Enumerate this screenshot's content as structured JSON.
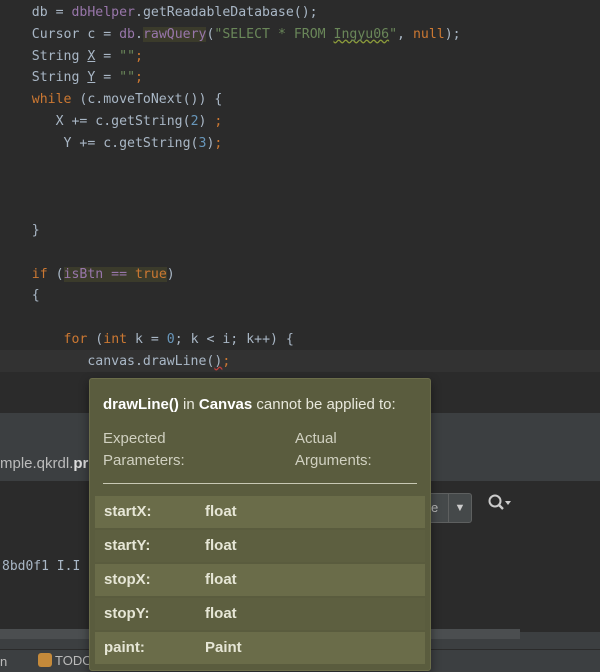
{
  "editor": {
    "lines": [
      {
        "segments": [
          {
            "t": "    db = ",
            "c": ""
          },
          {
            "t": "dbHelper",
            "c": "fld"
          },
          {
            "t": ".getReadableDatabase();",
            "c": ""
          }
        ]
      },
      {
        "segments": [
          {
            "t": "    Cursor c = ",
            "c": ""
          },
          {
            "t": "db",
            "c": "fld"
          },
          {
            "t": ".",
            "c": ""
          },
          {
            "t": "rawQuery",
            "c": "hlbox"
          },
          {
            "t": "(",
            "c": ""
          },
          {
            "t": "\"SELECT * FROM ",
            "c": "str"
          },
          {
            "t": "Ingyu06",
            "c": "strsq"
          },
          {
            "t": "\"",
            "c": "str"
          },
          {
            "t": ", ",
            "c": ""
          },
          {
            "t": "null",
            "c": "kw"
          },
          {
            "t": ");",
            "c": ""
          }
        ]
      },
      {
        "segments": [
          {
            "t": "    String ",
            "c": ""
          },
          {
            "t": "X",
            "c": "ul"
          },
          {
            "t": " = ",
            "c": ""
          },
          {
            "t": "\"\"",
            "c": "str"
          },
          {
            "t": ";",
            "c": "kw"
          }
        ]
      },
      {
        "segments": [
          {
            "t": "    String ",
            "c": ""
          },
          {
            "t": "Y",
            "c": "ul"
          },
          {
            "t": " = ",
            "c": ""
          },
          {
            "t": "\"\"",
            "c": "str"
          },
          {
            "t": ";",
            "c": "kw"
          }
        ]
      },
      {
        "segments": [
          {
            "t": "    ",
            "c": ""
          },
          {
            "t": "while",
            "c": "kw"
          },
          {
            "t": " (c.moveToNext()) {",
            "c": ""
          }
        ]
      },
      {
        "segments": [
          {
            "t": "       X += c.getString(",
            "c": ""
          },
          {
            "t": "2",
            "c": "num"
          },
          {
            "t": ") ",
            "c": ""
          },
          {
            "t": ";",
            "c": "kw"
          }
        ]
      },
      {
        "segments": [
          {
            "t": "        Y += c.getString(",
            "c": ""
          },
          {
            "t": "3",
            "c": "num"
          },
          {
            "t": ")",
            "c": ""
          },
          {
            "t": ";",
            "c": "kw"
          }
        ]
      },
      {
        "segments": []
      },
      {
        "segments": []
      },
      {
        "segments": []
      },
      {
        "segments": [
          {
            "t": "    }",
            "c": ""
          }
        ]
      },
      {
        "segments": []
      },
      {
        "segments": [
          {
            "t": "    ",
            "c": ""
          },
          {
            "t": "if",
            "c": "kw"
          },
          {
            "t": " (",
            "c": ""
          },
          {
            "t": "isBtn == ",
            "c": "hlfld"
          },
          {
            "t": "true",
            "c": "hlkw"
          },
          {
            "t": ")",
            "c": ""
          }
        ]
      },
      {
        "segments": [
          {
            "t": "    {",
            "c": ""
          }
        ]
      },
      {
        "segments": []
      },
      {
        "segments": [
          {
            "t": "        ",
            "c": ""
          },
          {
            "t": "for",
            "c": "kw"
          },
          {
            "t": " (",
            "c": ""
          },
          {
            "t": "int",
            "c": "kw"
          },
          {
            "t": " k = ",
            "c": ""
          },
          {
            "t": "0",
            "c": "num"
          },
          {
            "t": "; k < i; k++) {",
            "c": ""
          }
        ]
      },
      {
        "segments": [
          {
            "t": "           canvas.drawLine(",
            "c": ""
          },
          {
            "t": ")",
            "c": "err"
          },
          {
            "t": ";",
            "c": "kw"
          }
        ]
      }
    ]
  },
  "panel": {
    "tab_prefix": "mple.qkrdl.",
    "tab_bold": "pr",
    "log_line": "8bd0f1 I.I",
    "filter_value": "e",
    "filter_arrow": "▼",
    "search_icon": "🔍︎▾",
    "status_left": "n",
    "status_todo": "TODO"
  },
  "tooltip": {
    "method": "drawLine()",
    "in_text": " in ",
    "class": "Canvas",
    "suffix": " cannot be applied to:",
    "expected_1": "Expected",
    "expected_2": "Parameters:",
    "actual_1": "Actual",
    "actual_2": "Arguments:",
    "params": [
      {
        "name": "startX:",
        "type": "float"
      },
      {
        "name": "startY:",
        "type": "float"
      },
      {
        "name": "stopX:",
        "type": "float"
      },
      {
        "name": "stopY:",
        "type": "float"
      },
      {
        "name": "paint:",
        "type": "Paint"
      }
    ]
  },
  "colors": {
    "editor_bg": "#2b2b2b",
    "keyword": "#cc7832",
    "string": "#6a8759",
    "number": "#6897bb",
    "field": "#9876aa",
    "tooltip_bg": "#5a5c3e"
  }
}
